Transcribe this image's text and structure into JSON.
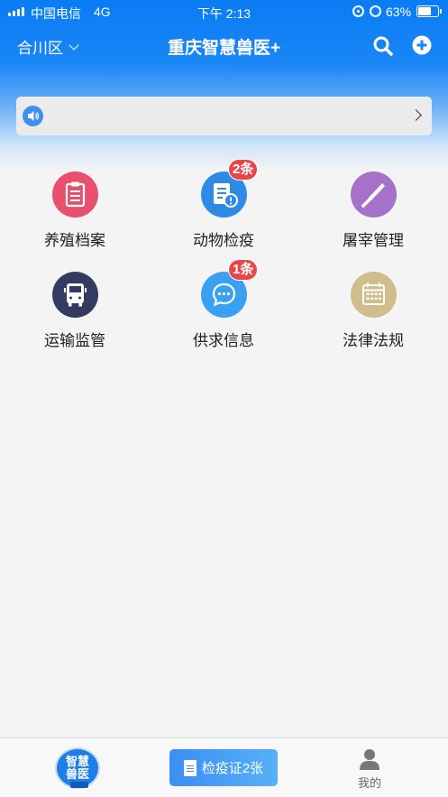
{
  "status_bar": {
    "carrier": "中国电信",
    "network": "4G",
    "time": "下午 2:13",
    "battery_text": "63%",
    "battery_level": 0.63
  },
  "nav": {
    "district": "合川区",
    "title": "重庆智慧兽医+",
    "icons": [
      "search-icon",
      "add-icon"
    ]
  },
  "notice": {
    "text": "",
    "icon": "speaker-icon"
  },
  "grid": [
    {
      "label": "养殖档案",
      "icon": "clipboard-icon",
      "color": "#e9506d",
      "badge": ""
    },
    {
      "label": "动物检疫",
      "icon": "quarantine-doc-icon",
      "color": "#2f8ae6",
      "badge": "2条"
    },
    {
      "label": "屠宰管理",
      "icon": "knife-icon",
      "color": "#a672c9",
      "badge": ""
    },
    {
      "label": "运输监管",
      "icon": "truck-icon",
      "color": "#343b63",
      "badge": ""
    },
    {
      "label": "供求信息",
      "icon": "chat-icon",
      "color": "#3aa1f2",
      "badge": "1条"
    },
    {
      "label": "法律法规",
      "icon": "calendar-icon",
      "color": "#d1bd8c",
      "badge": ""
    }
  ],
  "tab_bar": {
    "home_logo_text": "智慧兽医",
    "home_logo_line1": "智慧",
    "home_logo_line2": "兽医",
    "cert_button": "检疫证2张",
    "mine_label": "我的"
  },
  "colors": {
    "primary_blue": "#0a7cf4",
    "badge_red": "#e8474a"
  }
}
